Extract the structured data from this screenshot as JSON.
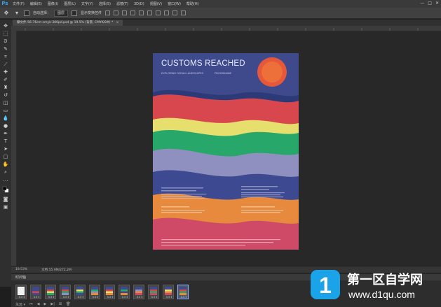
{
  "app": {
    "logo": "Ps"
  },
  "menubar": {
    "items": [
      "文件(F)",
      "编辑(E)",
      "图像(I)",
      "图层(L)",
      "文字(Y)",
      "选择(S)",
      "滤镜(T)",
      "3D(D)",
      "视图(V)",
      "窗口(W)",
      "帮助(H)"
    ],
    "window_buttons": [
      "—",
      "□",
      "✕"
    ]
  },
  "options_bar": {
    "tool_icon": "move-icon",
    "auto_select_label": "自动选择：",
    "auto_select_value": "图层",
    "show_transform_label": "显示变换控件"
  },
  "document": {
    "tab_title": "摩文件-56-76cm-cmyk-300pd.psd @ 19.5% (背景, CMYK/8#) *",
    "tab_close": "×"
  },
  "poster": {
    "title": "CUSTOMS REACHED",
    "subtitle_left": "EXPLORING OCEAN LANDSCAPES",
    "subtitle_right": "PROGRAMME",
    "colors": {
      "background": "#3f4a8c",
      "red": "#d8464e",
      "yellow": "#e6df6e",
      "green": "#27a86a",
      "lavender": "#8f90bf",
      "navy": "#3d4a91",
      "orange": "#e78a3d",
      "pink": "#cf4a66",
      "sun": "#e7583a"
    }
  },
  "status": {
    "zoom": "19.53%",
    "doc_size": "文档:55.9M/272.2M"
  },
  "timeline": {
    "title": "时间轴",
    "frame_delay": "0.5 ▾",
    "frame_count": 12,
    "selected_frame_index": 11,
    "controls": [
      "永远 ▾",
      "⏮",
      "◀",
      "▶",
      "▶|",
      "⊞",
      "🗑"
    ]
  },
  "watermark": {
    "logo_char": "1",
    "cn_text": "第一区自学网",
    "url_text": "www.d1qu.com",
    "colors": {
      "blue": "#1aa3e8"
    }
  }
}
